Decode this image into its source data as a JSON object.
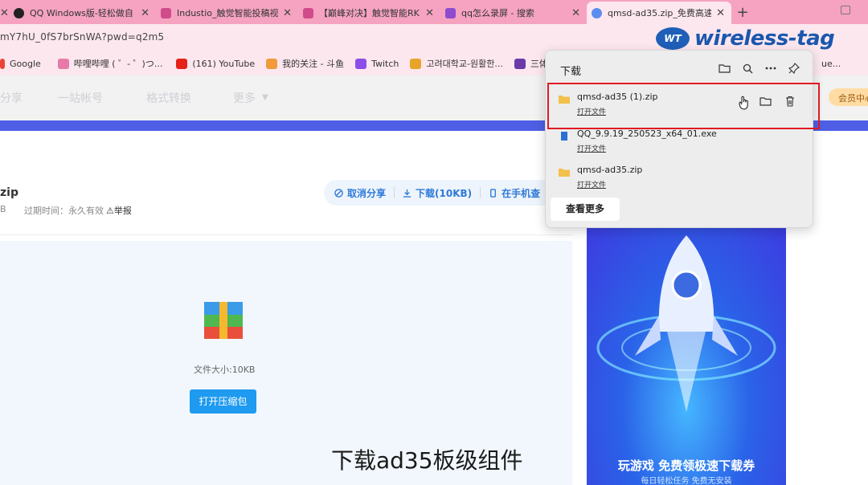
{
  "browser": {
    "tabs": [
      {
        "label": "QQ Windows版-轻松做自",
        "active": false
      },
      {
        "label": "Industio_触觉智能投稿视",
        "active": false
      },
      {
        "label": "【巅峰对决】触觉智能RK",
        "active": false
      },
      {
        "label": "qq怎么录屏 - 搜索",
        "active": false
      },
      {
        "label": "qmsd-ad35.zip_免费高速",
        "active": true
      }
    ],
    "new_tab": "+",
    "address": "mY7hU_0fS7brSnWA?pwd=q2m5"
  },
  "watermark": {
    "text": "wireless-tag",
    "mark": "WT"
  },
  "bookmarks": [
    "Google",
    "哔哩哔哩 ( ゜- ゜)つ...",
    "(161) YouTube",
    "我的关注 - 斗鱼",
    "Twitch",
    "고려대학교-원활한...",
    "三体_",
    "ue..."
  ],
  "site_nav": {
    "links": [
      "分享",
      "一站帐号",
      "格式转换",
      "更多"
    ],
    "vip": "会员中心"
  },
  "file": {
    "name_tail": "zip",
    "size_short": "B",
    "expire": "过期时间：永久有效",
    "report": "举报",
    "actions": {
      "cancel": "取消分享",
      "download": "下载(10KB)",
      "phone": "在手机查"
    },
    "size_label": "文件大小:10KB",
    "open_button": "打开压缩包"
  },
  "ad": {
    "line1": "玩游戏 免费领极速下载券",
    "line2": "每日轻松任务 免费无安装"
  },
  "downloads": {
    "title": "下载",
    "items": [
      {
        "name": "qmsd-ad35 (1).zip",
        "action": "打开文件"
      },
      {
        "name": "QQ_9.9.19_250523_x64_01.exe",
        "action": "打开文件"
      },
      {
        "name": "qmsd-ad35.zip",
        "action": "打开文件"
      }
    ],
    "see_more": "查看更多",
    "tool_icons": [
      "folder-icon",
      "search-icon",
      "more-icon",
      "pin-icon"
    ],
    "row_icons": [
      "hand-cursor-icon",
      "folder-icon",
      "trash-icon"
    ]
  },
  "subtitle": "下载ad35板级组件",
  "colors": {
    "tab_bar": "#f5a3c0",
    "accent_blue": "#4e5fe5",
    "highlight": "#e01a22",
    "link_blue": "#2e7ad9",
    "button_blue": "#1e9af0"
  }
}
